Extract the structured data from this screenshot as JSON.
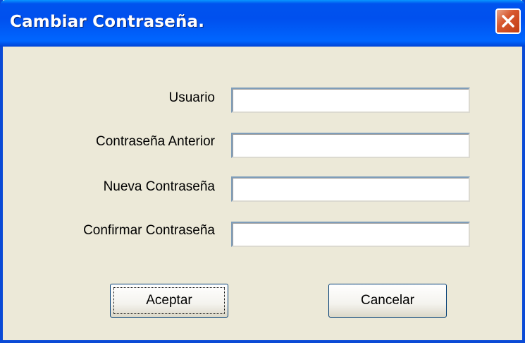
{
  "window": {
    "title": "Cambiar Contraseña."
  },
  "icons": {
    "close": "close-icon"
  },
  "form": {
    "fields": [
      {
        "label": "Usuario",
        "value": ""
      },
      {
        "label": "Contraseña Anterior",
        "value": ""
      },
      {
        "label": "Nueva Contraseña",
        "value": ""
      },
      {
        "label": "Confirmar Contraseña",
        "value": ""
      }
    ]
  },
  "buttons": {
    "accept_label": "Aceptar",
    "cancel_label": "Cancelar"
  },
  "colors": {
    "titlebar": "#0053ee",
    "dialog_background": "#ece9d8",
    "close_button": "#d7582f"
  }
}
